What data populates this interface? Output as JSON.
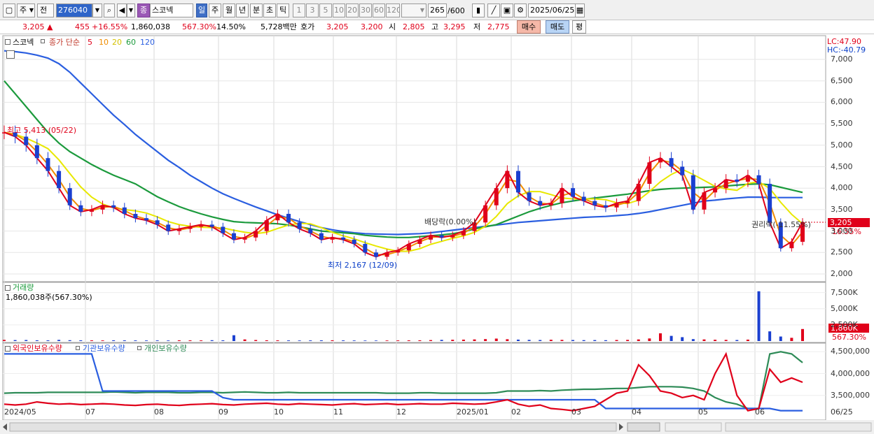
{
  "toolbar": {
    "market": "주",
    "period": "전",
    "code": "276040",
    "badge": "종",
    "name": "스코넥",
    "units": [
      "일",
      "주",
      "월",
      "년",
      "분",
      "초",
      "틱"
    ],
    "intervals": [
      "1",
      "3",
      "5",
      "10",
      "20",
      "30",
      "60",
      "120"
    ],
    "count": "265",
    "total": "/600",
    "date": "2025/06/25"
  },
  "quote": {
    "price": "3,205",
    "arrow": "▲",
    "change": "455",
    "rate": "+16.55%",
    "volume": "1,860,038",
    "vol_ratio": "567.30%",
    "turnover": "14.50%",
    "amount": "5,728백만",
    "hoga_label": "호가",
    "ask": "3,205",
    "bid": "3,200",
    "open_label": "시",
    "open": "2,805",
    "high_label": "고",
    "high": "3,295",
    "low_label": "저",
    "low": "2,775",
    "buy": "매수",
    "sell": "매도",
    "eval": "평"
  },
  "price_panel": {
    "name": "스코넥",
    "legend_label": "종가 단순",
    "ma": [
      {
        "label": "5",
        "color": "#e0001a"
      },
      {
        "label": "10",
        "color": "#f08c00"
      },
      {
        "label": "20",
        "color": "#e8e800"
      },
      {
        "label": "60",
        "color": "#1b9a3c"
      },
      {
        "label": "120",
        "color": "#2a5ee0"
      }
    ],
    "lc": "LC:47.90",
    "hc": "HC:-40.79",
    "y_ticks": [
      "7,000",
      "6,500",
      "6,000",
      "5,500",
      "5,000",
      "4,500",
      "4,000",
      "3,500",
      "3,000",
      "2,500",
      "2,000"
    ],
    "current_tag": "3,205",
    "current_pct": "16.55%",
    "ann_high": "최고 5,413 (05/22)",
    "ann_low": "최저 2,167 (12/09)",
    "ann_dividend": "배당락(0.00%)",
    "ann_rights": "권리락(-11.55%)"
  },
  "volume_panel": {
    "title": "거래량",
    "value_text": "1,860,038주(567.30%)",
    "y_ticks": [
      "7,500K",
      "5,000K",
      "2,500K"
    ],
    "current_tag": "1,860K",
    "current_pct": "567.30%"
  },
  "holding_panel": {
    "legend": [
      "외국인보유수량",
      "기관보유수량",
      "개인보유수량"
    ],
    "colors": [
      "#e0001a",
      "#2a5ee0",
      "#2e8b57"
    ],
    "y_ticks": [
      "4,500,000",
      "4,000,000",
      "3,500,000"
    ]
  },
  "x_labels": [
    "2024/05",
    "07",
    "08",
    "09",
    "10",
    "11",
    "12",
    "2025/01",
    "02",
    "03",
    "04",
    "05",
    "06",
    "06/25"
  ],
  "chart_data": {
    "type": "line",
    "y_range_price": [
      2000,
      7000
    ],
    "y_range_volume_k": [
      0,
      8000
    ],
    "y_range_holding": [
      3000000,
      4600000
    ],
    "close": [
      5300,
      5200,
      5000,
      4700,
      4400,
      4000,
      3600,
      3450,
      3500,
      3600,
      3550,
      3400,
      3300,
      3250,
      3150,
      3000,
      3050,
      3100,
      3150,
      3100,
      2950,
      2800,
      2850,
      3000,
      3250,
      3400,
      3200,
      3050,
      2950,
      2800,
      2850,
      2800,
      2700,
      2500,
      2400,
      2500,
      2550,
      2700,
      2800,
      2900,
      2850,
      2900,
      3000,
      3200,
      3600,
      4000,
      4400,
      3900,
      3700,
      3600,
      3650,
      4000,
      3800,
      3700,
      3600,
      3550,
      3650,
      3700,
      4100,
      4600,
      4700,
      4500,
      4300,
      3500,
      3900,
      4000,
      4200,
      4150,
      4300,
      4100,
      3200,
      2600,
      2750,
      3205
    ],
    "ma120": [
      7200,
      7180,
      7150,
      7100,
      7030,
      6900,
      6700,
      6450,
      6200,
      5950,
      5700,
      5480,
      5250,
      5050,
      4850,
      4650,
      4480,
      4300,
      4150,
      4000,
      3870,
      3760,
      3660,
      3560,
      3470,
      3380,
      3300,
      3220,
      3150,
      3080,
      3030,
      2990,
      2960,
      2940,
      2930,
      2925,
      2920,
      2930,
      2940,
      2960,
      2990,
      3020,
      3050,
      3080,
      3110,
      3140,
      3170,
      3200,
      3220,
      3240,
      3260,
      3280,
      3300,
      3320,
      3330,
      3340,
      3360,
      3380,
      3410,
      3450,
      3500,
      3550,
      3600,
      3650,
      3700,
      3720,
      3750,
      3770,
      3790,
      3790,
      3780,
      3780,
      3780,
      3780
    ],
    "ma60": [
      6500,
      6200,
      5900,
      5600,
      5300,
      5050,
      4850,
      4700,
      4550,
      4420,
      4300,
      4200,
      4100,
      3950,
      3800,
      3680,
      3570,
      3480,
      3400,
      3330,
      3270,
      3220,
      3200,
      3190,
      3180,
      3170,
      3140,
      3100,
      3050,
      3000,
      2980,
      2960,
      2940,
      2900,
      2880,
      2860,
      2850,
      2850,
      2870,
      2890,
      2910,
      2940,
      2980,
      3050,
      3100,
      3150,
      3250,
      3350,
      3450,
      3530,
      3600,
      3660,
      3700,
      3740,
      3770,
      3800,
      3830,
      3860,
      3900,
      3940,
      3970,
      3990,
      4000,
      4010,
      4020,
      4030,
      4050,
      4070,
      4090,
      4100,
      4080,
      4020,
      3960,
      3900
    ],
    "volume_k": [
      180,
      150,
      160,
      120,
      110,
      180,
      130,
      120,
      110,
      100,
      120,
      110,
      100,
      90,
      100,
      90,
      120,
      110,
      100,
      130,
      110,
      900,
      250,
      160,
      120,
      110,
      100,
      90,
      100,
      110,
      120,
      100,
      90,
      80,
      80,
      90,
      100,
      110,
      120,
      150,
      180,
      200,
      220,
      250,
      300,
      380,
      280,
      220,
      180,
      160,
      200,
      180,
      160,
      140,
      150,
      130,
      160,
      180,
      250,
      400,
      1200,
      800,
      600,
      300,
      250,
      200,
      180,
      160,
      220,
      7700,
      1500,
      700,
      500,
      1860
    ]
  }
}
